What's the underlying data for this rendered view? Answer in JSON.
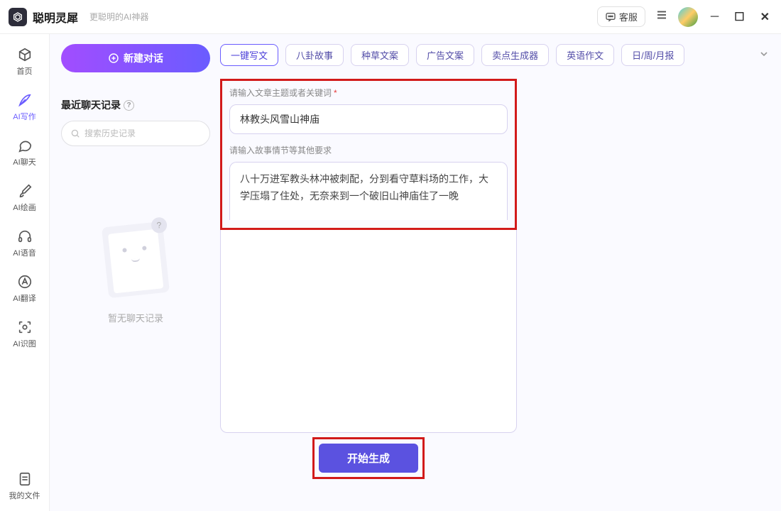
{
  "titlebar": {
    "app_title": "聪明灵犀",
    "app_subtitle": "更聪明的AI神器",
    "kefu_label": "客服"
  },
  "sidebar": {
    "items": [
      {
        "label": "首页"
      },
      {
        "label": "AI写作"
      },
      {
        "label": "AI聊天"
      },
      {
        "label": "AI绘画"
      },
      {
        "label": "AI语音"
      },
      {
        "label": "AI翻译"
      },
      {
        "label": "AI识图"
      }
    ],
    "bottom": {
      "label": "我的文件"
    }
  },
  "history": {
    "new_chat_label": "新建对话",
    "title": "最近聊天记录",
    "help_badge": "?",
    "search_placeholder": "搜索历史记录",
    "empty_text": "暂无聊天记录",
    "empty_badge": "?"
  },
  "tags": {
    "items": [
      "一键写文",
      "八卦故事",
      "种草文案",
      "广告文案",
      "卖点生成器",
      "英语作文",
      "日/周/月报"
    ]
  },
  "form": {
    "topic_label": "请输入文章主题或者关键词",
    "required_mark": "*",
    "topic_value": "林教头风雪山神庙",
    "details_label": "请输入故事情节等其他要求",
    "details_value": "八十万进军教头林冲被刺配，分到看守草料场的工作，大学压塌了住处，无奈来到一个破旧山神庙住了一晚"
  },
  "actions": {
    "generate_label": "开始生成"
  }
}
